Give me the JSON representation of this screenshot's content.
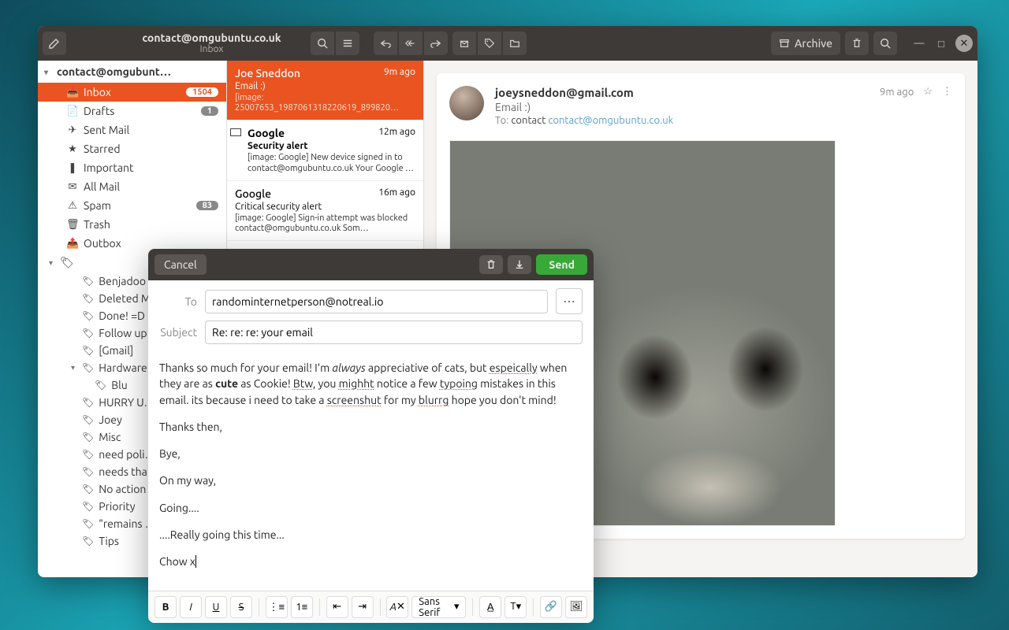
{
  "window": {
    "title": "contact@omgubuntu.co.uk",
    "subtitle": "Inbox",
    "archive_label": "Archive"
  },
  "sidebar": {
    "account": "contact@omgubunt…",
    "folders": [
      {
        "icon": "inbox",
        "label": "Inbox",
        "badge": "1504",
        "active": true
      },
      {
        "icon": "drafts",
        "label": "Drafts",
        "badge": "1"
      },
      {
        "icon": "sent",
        "label": "Sent Mail"
      },
      {
        "icon": "star",
        "label": "Starred"
      },
      {
        "icon": "important",
        "label": "Important"
      },
      {
        "icon": "allmail",
        "label": "All Mail"
      },
      {
        "icon": "spam",
        "label": "Spam",
        "badge": "83"
      },
      {
        "icon": "trash",
        "label": "Trash"
      },
      {
        "icon": "outbox",
        "label": "Outbox"
      }
    ],
    "labels": [
      "Benjadoo",
      "Deleted M…",
      "Done! =D",
      "Follow up",
      "[Gmail]",
      "Hardware",
      "Blu",
      "HURRY U…",
      "Joey",
      "Misc",
      "need poli…",
      "needs tha…",
      "No action",
      "Priority",
      "\"remains …",
      "Tips"
    ]
  },
  "messages": [
    {
      "from": "Joe Sneddon",
      "time": "9m ago",
      "subject": "Email :)",
      "preview": "[image: 25007653_1987061318220619_899820…",
      "selected": true
    },
    {
      "from": "Google",
      "time": "12m ago",
      "subject": "Security alert",
      "preview": "[image: Google] New device signed in to contact@omgubuntu.co.uk Your Google …",
      "unread": true
    },
    {
      "from": "Google",
      "time": "16m ago",
      "subject": "Critical security alert",
      "preview": "[image: Google] Sign-in attempt was blocked contact@omgubuntu.co.uk Som…"
    }
  ],
  "reader": {
    "from": "joeysneddon@gmail.com",
    "subject": "Email :)",
    "to_label": "To:",
    "to_name": "contact",
    "to_addr": "contact@omgubuntu.co.uk",
    "time": "9m ago"
  },
  "compose": {
    "cancel": "Cancel",
    "send": "Send",
    "to_label": "To",
    "to_value": "randominternetperson@notreal.io",
    "subject_label": "Subject",
    "subject_value": "Re: re: re: your email",
    "body": {
      "p1_a": "Thanks so much for your email! I'm ",
      "p1_always": "always",
      "p1_b": " appreciative of cats, but ",
      "p1_espeically": "espeically",
      "p1_c": " when they are as ",
      "p1_cute": "cute",
      "p1_d": " as Cookie! ",
      "p1_btw": "Btw",
      "p1_e": ", you ",
      "p1_mighht": "mighht",
      "p1_f": " notice a few ",
      "p1_typoing": "typoing",
      "p1_g": " mistakes in this email. its because i need to take a ",
      "p1_screenshut": "screenshut",
      "p1_h": " for my ",
      "p1_blurrg": "blurrg",
      "p1_i": " hope you don't mind!",
      "p2": "Thanks then,",
      "p3": "Bye,",
      "p4": "On my way,",
      "p5": "Going....",
      "p6": "....Really going this time...",
      "p7": "Chow x"
    },
    "font": "Sans Serif"
  }
}
